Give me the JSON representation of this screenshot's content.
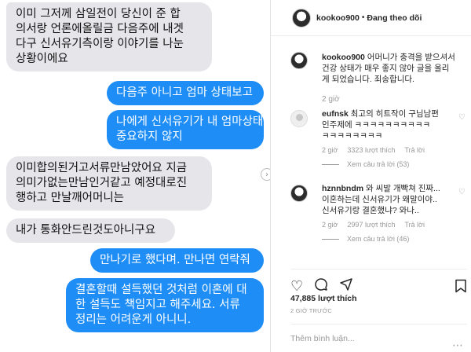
{
  "chat": {
    "messages": [
      {
        "side": "in",
        "lines": [
          "이미 그저께 삼일전이 당신이 준 합",
          "의서랑 언론에올릴금 다음주에 내겟",
          "다구 신서유기측이랑 이야기를 나눈",
          "상황이에요"
        ]
      },
      {
        "side": "out",
        "lines": [
          "다음주 아니고 엄마 상태보고"
        ]
      },
      {
        "side": "out",
        "lines": [
          "나에게 신서유기가 내 엄마상태보다",
          "중요하지 않지"
        ]
      },
      {
        "side": "in",
        "lines": [
          "이미합의된거고서류만남았어요 지금",
          "의미가없는만남인거같고 예정대로진",
          "행하고 만날깨어머니는"
        ]
      },
      {
        "side": "in",
        "lines": [
          "내가 통화안드린것도아니구요"
        ]
      },
      {
        "side": "out",
        "lines": [
          "만나기로 했다며. 만나면 연락줘"
        ]
      },
      {
        "side": "out",
        "lines": [
          "결혼할때 설득했던 것처럼 이혼에 대",
          "한 설득도 책임지고 해주세요. 서류",
          "정리는 어려운게 아니니."
        ]
      }
    ],
    "scroll_icon": "chevron-right-icon"
  },
  "instagram": {
    "header": {
      "username": "kookoo900",
      "separator": "•",
      "follow_status": "Đang theo dõi"
    },
    "caption": {
      "username": "kookoo900",
      "text_lines": [
        "어머니가 충격을 받으셔서",
        "건강 상태가 매우 좋지 않아 글을 올리",
        "게 되었습니다. 죄송합니다."
      ],
      "time": "2 giờ"
    },
    "comments": [
      {
        "username": "eufnsk",
        "text_lines": [
          "최고의 히트작이 구님남편",
          "인주제에 ㅋㅋㅋㅋㅋㅋㅋㅋㅋㅋ",
          "ㅋㅋㅋㅋㅋㅋㅋㅋ"
        ],
        "time": "2 giờ",
        "likes": "3323 lượt thích",
        "reply": "Trả lời",
        "replies": "Xem câu trả lời (53)"
      },
      {
        "username": "hznnbndm",
        "text_lines": [
          "와 씨발 개빡쳐 진짜...",
          "이혼하는데 신서유기가 왜말이야..",
          "신서유기랑 결혼했냐? 와나.."
        ],
        "time": "2 giờ",
        "likes": "2997 lượt thích",
        "reply": "Trả lời",
        "replies": "Xem câu trả lời (46)"
      }
    ],
    "actions": {
      "like_icon": "heart-icon",
      "comment_icon": "comment-icon",
      "share_icon": "share-icon",
      "save_icon": "bookmark-icon"
    },
    "likes": "47,885 lượt thích",
    "post_time": "2 GIỜ TRƯỚC",
    "comment_placeholder": "Thêm bình luận...",
    "more_icon": "more-dots-icon"
  }
}
